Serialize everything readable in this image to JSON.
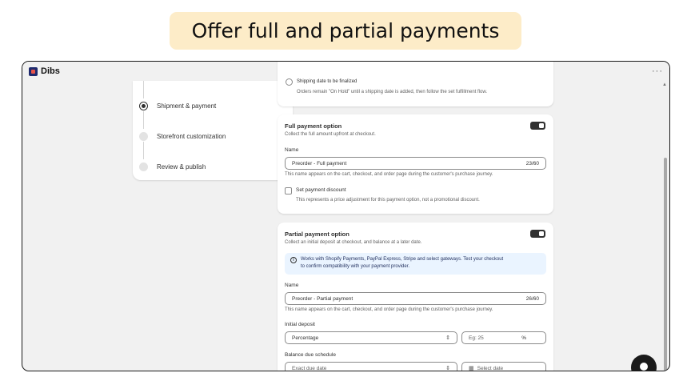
{
  "headline": "Offer full and partial payments",
  "app": {
    "name": "Dibs",
    "more": "···"
  },
  "steps": [
    {
      "label": "Shipment & payment"
    },
    {
      "label": "Storefront customization"
    },
    {
      "label": "Review & publish"
    }
  ],
  "shipping_option": {
    "label": "Shipping date to be finalized",
    "description": "Orders remain \"On Hold\" until a shipping date is added, then follow the set fulfillment flow."
  },
  "full_payment": {
    "title": "Full payment option",
    "subtitle": "Collect the full amount upfront at checkout.",
    "name_label": "Name",
    "name_value": "Preorder - Full payment",
    "name_count": "23/60",
    "name_help": "This name appears on the cart, checkout, and order page during the customer's purchase journey.",
    "discount_label": "Set payment discount",
    "discount_help": "This represents a price adjustment for this payment option, not a promotional discount."
  },
  "partial_payment": {
    "title": "Partial payment option",
    "subtitle": "Collect an initial deposit at checkout, and balance at a later date.",
    "banner_line1": "Works with Shopify Payments, PayPal Express, Stripe and select gateways. Test your checkout",
    "banner_line2": "to confirm compatibility with your payment provider.",
    "name_label": "Name",
    "name_value": "Preorder - Partial payment",
    "name_count": "26/60",
    "name_help": "This name appears on the cart, checkout, and order page during the customer's purchase journey.",
    "deposit_label": "Initial deposit",
    "deposit_type": "Percentage",
    "deposit_placeholder": "Eg: 25",
    "deposit_unit": "%",
    "balance_label": "Balance due schedule",
    "balance_type": "Exact due date",
    "balance_date_placeholder": "Select date"
  }
}
